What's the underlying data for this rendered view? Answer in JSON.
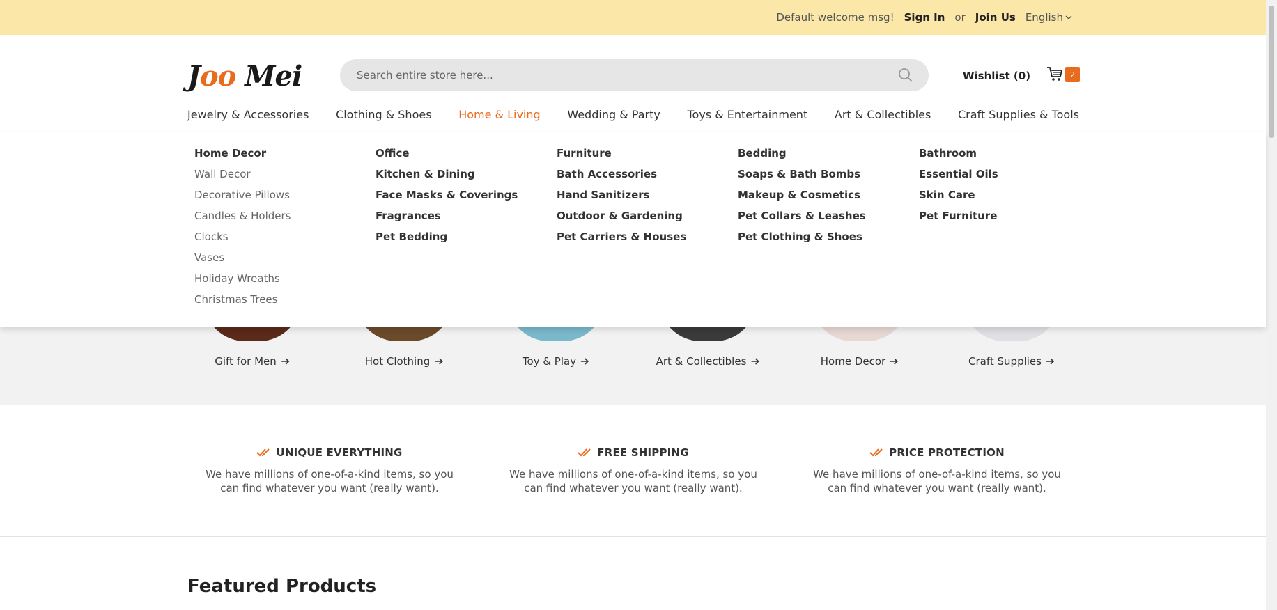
{
  "topbar": {
    "welcome": "Default welcome msg!",
    "sign_in": "Sign In",
    "or": "or",
    "join_us": "Join Us",
    "language": "English"
  },
  "header": {
    "logo_part1": "J",
    "logo_part2": "oo",
    "logo_part3": " Mei",
    "search_placeholder": "Search entire store here...",
    "wishlist": "Wishlist (0)",
    "cart_count": "2"
  },
  "nav": [
    "Jewelry & Accessories",
    "Clothing & Shoes",
    "Home & Living",
    "Wedding & Party",
    "Toys & Entertainment",
    "Art & Collectibles",
    "Craft Supplies & Tools"
  ],
  "mega_menu": {
    "col1": {
      "heading": "Home Decor",
      "items": [
        "Wall Decor",
        "Decorative Pillows",
        "Candles & Holders",
        "Clocks",
        "Vases",
        "Holiday Wreaths",
        "Christmas Trees"
      ]
    },
    "col2": [
      "Office",
      "Kitchen & Dining",
      "Face Masks & Coverings",
      "Fragrances",
      "Pet Bedding"
    ],
    "col3": [
      "Furniture",
      "Bath Accessories",
      "Hand Sanitizers",
      "Outdoor & Gardening",
      "Pet Carriers & Houses"
    ],
    "col4": [
      "Bedding",
      "Soaps & Bath Bombs",
      "Makeup & Cosmetics",
      "Pet Collars & Leashes",
      "Pet Clothing & Shoes"
    ],
    "col5": [
      "Bathroom",
      "Essential Oils",
      "Skin Care",
      "Pet Furniture"
    ]
  },
  "categories": [
    "Gift for Men",
    "Hot Clothing",
    "Toy & Play",
    "Art & Collectibles",
    "Home Decor",
    "Craft Supplies"
  ],
  "features": [
    {
      "title": "UNIQUE EVERYTHING",
      "desc": "We have millions of one-of-a-kind items, so you can find whatever you want (really want)."
    },
    {
      "title": "FREE SHIPPING",
      "desc": "We have millions of one-of-a-kind items, so you can find whatever you want (really want)."
    },
    {
      "title": "PRICE PROTECTION",
      "desc": "We have millions of one-of-a-kind items, so you can find whatever you want (really want)."
    }
  ],
  "featured_title": "Featured Products",
  "colors": {
    "accent": "#e96b1d",
    "topbar": "#fbe7a8"
  }
}
